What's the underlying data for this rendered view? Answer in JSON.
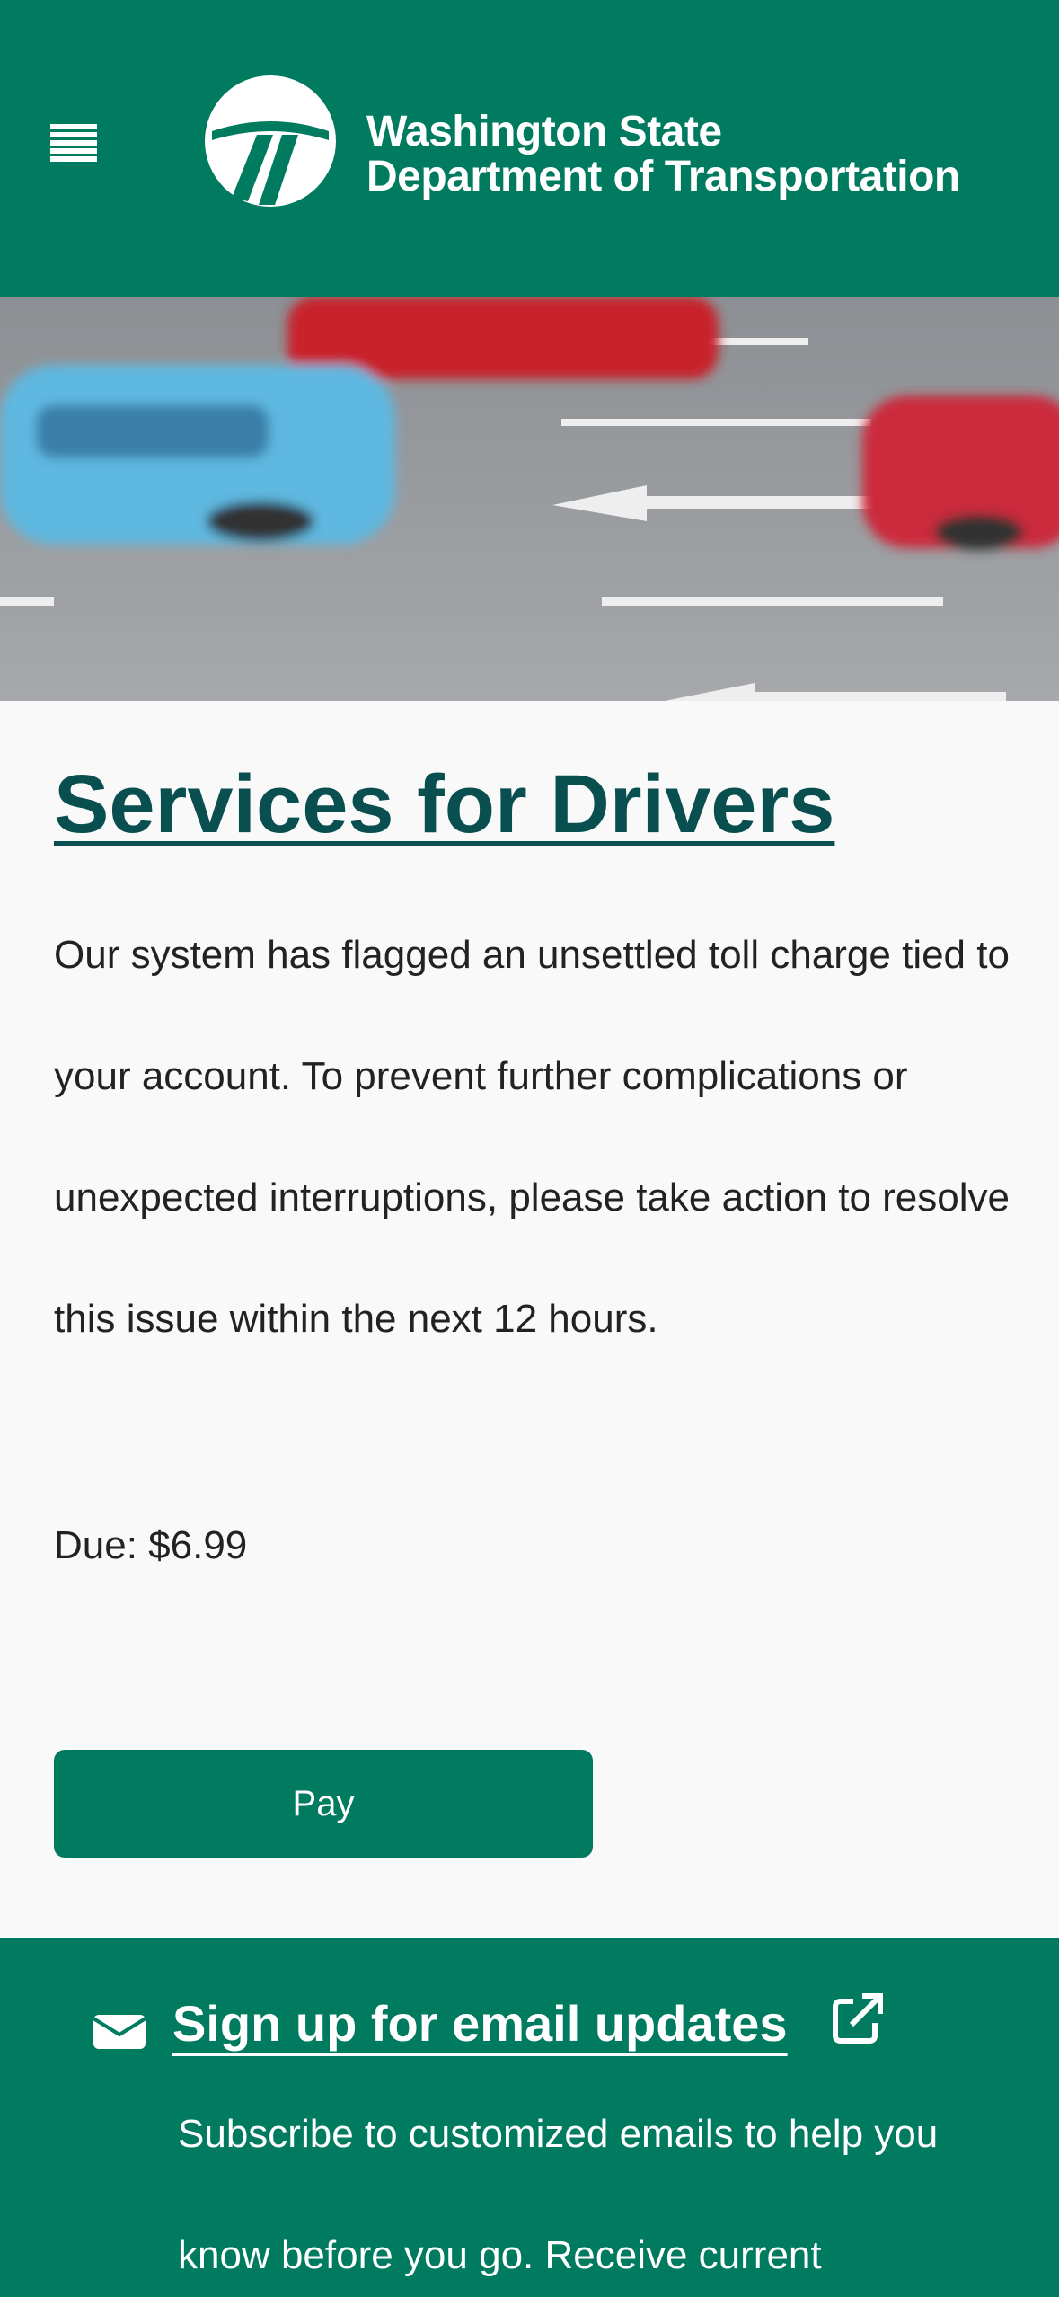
{
  "header": {
    "menu_icon": "hamburger-menu-icon",
    "logo_line1": "Washington State",
    "logo_line2": "Department of Transportation",
    "background_color": "#007b5f"
  },
  "hero": {
    "description_icon": "traffic-photo"
  },
  "main": {
    "title": "Services for Drivers",
    "body": "Our system has flagged an unsettled toll charge tied to your account. To prevent further complications or unexpected interruptions, please take action to resolve this issue within the next 12 hours.",
    "due": "Due: $6.99",
    "pay_label": "Pay",
    "title_color": "#0a4f4f"
  },
  "footer": {
    "signup_label": "Sign up for email updates",
    "signup_icon": "envelope-icon",
    "external_icon": "external-link-icon",
    "text": "Subscribe to customized emails to help you know before you go. Receive current"
  }
}
